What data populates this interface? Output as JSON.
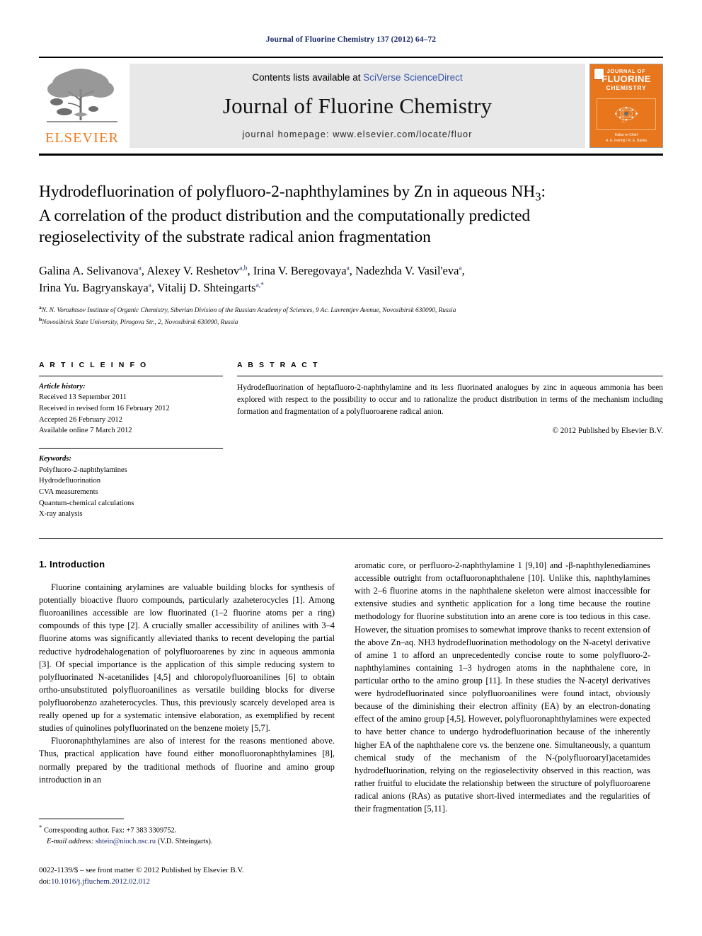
{
  "running_head": "Journal of Fluorine Chemistry 137 (2012) 64–72",
  "masthead": {
    "contents_prefix": "Contents lists available at ",
    "sciencedirect_link": "SciVerse ScienceDirect",
    "journal_title": "Journal of Fluorine Chemistry",
    "homepage": "journal homepage: www.elsevier.com/locate/fluor",
    "publisher_wordmark": "ELSEVIER",
    "publisher_logo_icon": "elsevier-tree-logo",
    "cover": {
      "line1": "JOURNAL OF",
      "line2": "FLUORINE",
      "line3": "CHEMISTRY",
      "foot1": "Editor-in-Chief",
      "foot2": "A. E. Feiring / R. E. Banks",
      "art_icon": "atom-orbital-icon",
      "bg_color": "#e8761d"
    }
  },
  "article": {
    "title_line1": "Hydrodefluorination of polyfluoro-2-naphthylamines by Zn in aqueous NH",
    "title_sub1": "3",
    "title_line1_tail": ":",
    "title_line2": "A correlation of the product distribution and the computationally predicted",
    "title_line3": "regioselectivity of the substrate radical anion fragmentation",
    "authors_line1": "Galina A. Selivanova a, Alexey V. Reshetov a,b, Irina V. Beregovaya a, Nadezhda V. Vasil'eva a,",
    "authors_line2": "Irina Yu. Bagryanskaya a, Vitalij D. Shteingarts a,*",
    "authors": [
      {
        "name": "Galina A. Selivanova",
        "sup": "a"
      },
      {
        "name": "Alexey V. Reshetov",
        "sup": "a,b"
      },
      {
        "name": "Irina V. Beregovaya",
        "sup": "a"
      },
      {
        "name": "Nadezhda V. Vasil'eva",
        "sup": "a"
      },
      {
        "name": "Irina Yu. Bagryanskaya",
        "sup": "a"
      },
      {
        "name": "Vitalij D. Shteingarts",
        "sup": "a,*"
      }
    ],
    "affiliation_a_sup": "a",
    "affiliation_a": "N. N. Vorozhtsov Institute of Organic Chemistry, Siberian Division of the Russian Academy of Sciences, 9 Ac. Lavrentjev Avenue, Novosibirsk 630090, Russia",
    "affiliation_b_sup": "b",
    "affiliation_b": "Novosibirsk State University, Pirogova Str., 2, Novosibirsk 630090, Russia"
  },
  "article_info": {
    "heading": "A R T I C L E  I N F O",
    "history_label": "Article history:",
    "history": [
      "Received 13 September 2011",
      "Received in revised form 16 February 2012",
      "Accepted 26 February 2012",
      "Available online 7 March 2012"
    ],
    "keywords_label": "Keywords:",
    "keywords": [
      "Polyfluoro-2-naphthylamines",
      "Hydrodefluorination",
      "CVA measurements",
      "Quantum-chemical calculations",
      "X-ray analysis"
    ]
  },
  "abstract": {
    "heading": "A B S T R A C T",
    "text": "Hydrodefluorination of heptafluoro-2-naphthylamine and its less fluorinated analogues by zinc in aqueous ammonia has been explored with respect to the possibility to occur and to rationalize the product distribution in terms of the mechanism including formation and fragmentation of a polyfluoroarene radical anion.",
    "copyright": "© 2012 Published by Elsevier B.V."
  },
  "body": {
    "section_number_title": "1. Introduction",
    "left_paragraphs": [
      "Fluorine containing arylamines are valuable building blocks for synthesis of potentially bioactive fluoro compounds, particularly azaheterocycles [1]. Among fluoroanilines accessible are low fluorinated (1–2 fluorine atoms per a ring) compounds of this type [2]. A crucially smaller accessibility of anilines with 3–4 fluorine atoms was significantly alleviated thanks to recent developing the partial reductive hydrodehalogenation of polyfluoroarenes by zinc in aqueous ammonia [3]. Of special importance is the application of this simple reducing system to polyfluorinated N-acetanilides [4,5] and chloropolyfluoroanilines [6] to obtain ortho-unsubstituted polyfluoroanilines as versatile building blocks for diverse polyfluorobenzo azaheterocycles. Thus, this previously scarcely developed area is really opened up for a systematic intensive elaboration, as exemplified by recent studies of quinolines polyfluorinated on the benzene moiety [5,7].",
      "Fluoronaphthylamines are also of interest for the reasons mentioned above. Thus, practical application have found either monofluoronaphthylamines [8], normally prepared by the traditional methods of fluorine and amino group introduction in an"
    ],
    "right_paragraphs": [
      "aromatic core, or perfluoro-2-naphthylamine 1 [9,10] and -β-naphthylenediamines accessible outright from octafluoronaphthalene [10]. Unlike this, naphthylamines with 2–6 fluorine atoms in the naphthalene skeleton were almost inaccessible for extensive studies and synthetic application for a long time because the routine methodology for fluorine substitution into an arene core is too tedious in this case. However, the situation promises to somewhat improve thanks to recent extension of the above Zn–aq. NH3 hydrodefluorination methodology on the N-acetyl derivative of amine 1 to afford an unprecedentedly concise route to some polyfluoro-2-naphthylamines containing 1–3 hydrogen atoms in the naphthalene core, in particular ortho to the amino group [11]. In these studies the N-acetyl derivatives were hydrodefluorinated since polyfluoroanilines were found intact, obviously because of the diminishing their electron affinity (EA) by an electron-donating effect of the amino group [4,5]. However, polyfluoronaphthylamines were expected to have better chance to undergo hydrodefluorination because of the inherently higher EA of the naphthalene core vs. the benzene one. Simultaneously, a quantum chemical study of the mechanism of the N-(polyfluoroaryl)acetamides hydrodefluorination, relying on the regioselectivity observed in this reaction, was rather fruitful to elucidate the relationship between the structure of polyfluoroarene radical anions (RAs) as putative short-lived intermediates and the regularities of their fragmentation [5,11]."
    ]
  },
  "footnote": {
    "star": "*",
    "corresponding": "Corresponding author. Fax: +7 383 3309752.",
    "email_label": "E-mail address:",
    "email": "shtein@nioch.nsc.ru",
    "email_owner": "(V.D. Shteingarts)."
  },
  "footer": {
    "issn_line": "0022-1139/$ – see front matter © 2012 Published by Elsevier B.V.",
    "doi_label": "doi:",
    "doi": "10.1016/j.jfluchem.2012.02.012"
  }
}
